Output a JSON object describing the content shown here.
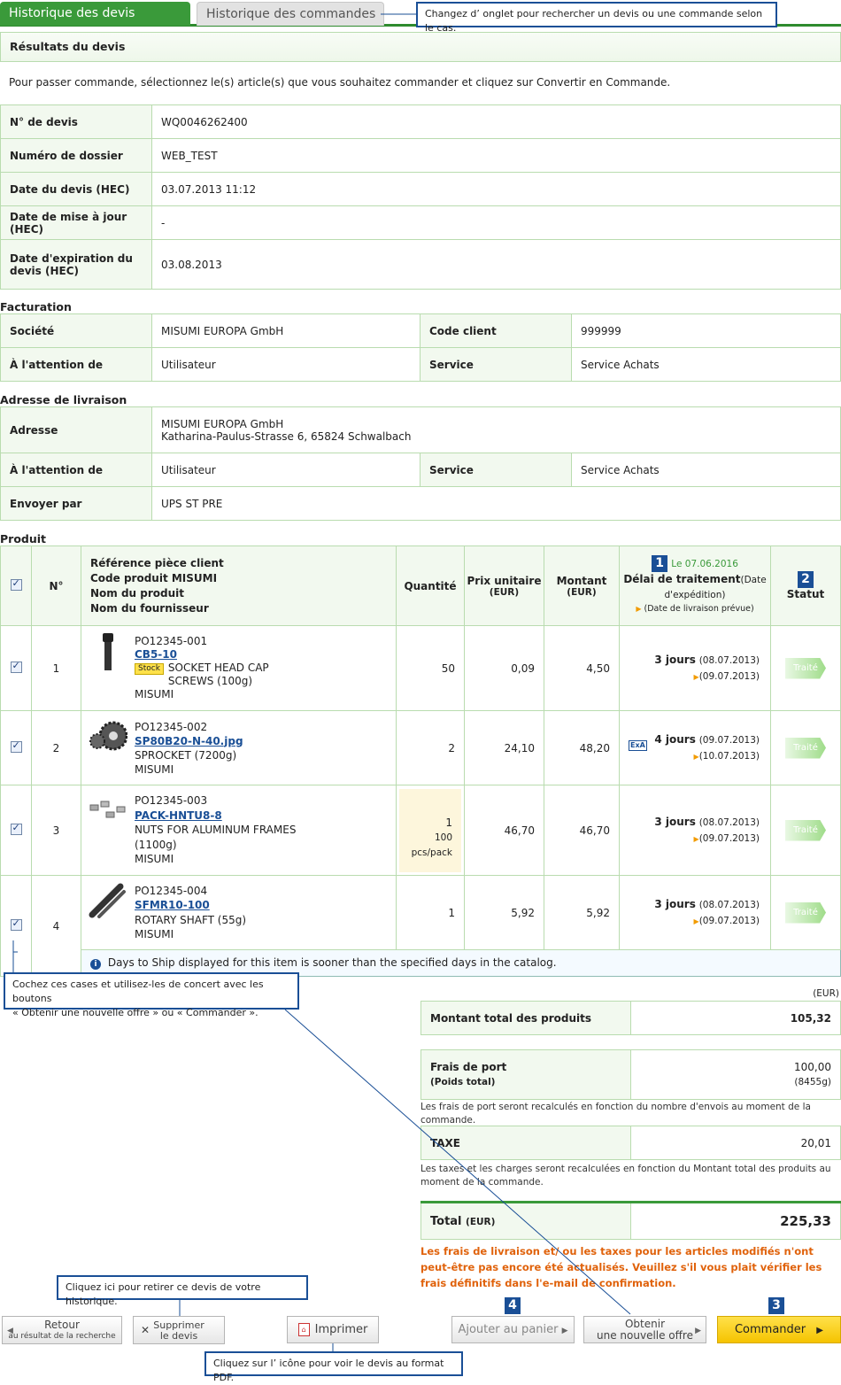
{
  "tabs": {
    "active": "Historique des devis",
    "inactive": "Historique des commandes"
  },
  "callouts": {
    "tabs": "Changez d’ onglet pour rechercher un devis ou une commande selon le cas.",
    "checkboxes_line1": "Cochez ces cases et utilisez-les de concert avec les boutons",
    "checkboxes_line2": "« Obtenir une nouvelle offre » ou « Commander ».",
    "delete": "Cliquez ici pour retirer ce devis de votre historique.",
    "pdf": "Cliquez sur l’ icône pour voir le devis au format PDF."
  },
  "header": {
    "title": "Résultats du devis",
    "intro": "Pour passer commande, sélectionnez le(s) article(s) que vous souhaitez commander et cliquez sur Convertir en Commande."
  },
  "quote_info": [
    {
      "label": "N° de devis",
      "value": "WQ0046262400"
    },
    {
      "label": "Numéro de dossier",
      "value": "WEB_TEST"
    },
    {
      "label": "Date du devis (HEC)",
      "value": "03.07.2013 11:12"
    },
    {
      "label": "Date de mise à jour (HEC)",
      "value": "-"
    },
    {
      "label": "Date d'expiration du devis (HEC)",
      "value": "03.08.2013"
    }
  ],
  "billing": {
    "title": "Facturation",
    "company_label": "Société",
    "company": "MISUMI EUROPA GmbH",
    "client_code_label": "Code client",
    "client_code": "999999",
    "attention_label": "À l'attention de",
    "attention": "Utilisateur",
    "service_label": "Service",
    "service": "Service Achats"
  },
  "shipping": {
    "title": "Adresse de livraison",
    "address_label": "Adresse",
    "address_line1": "MISUMI EUROPA GmbH",
    "address_line2": "Katharina-Paulus-Strasse 6, 65824 Schwalbach",
    "attention_label": "À l'attention de",
    "attention": "Utilisateur",
    "service_label": "Service",
    "service": "Service Achats",
    "ship_by_label": "Envoyer par",
    "ship_by": "UPS ST PRE"
  },
  "products": {
    "title": "Produit",
    "headers": {
      "no": "N°",
      "ref1": "Référence pièce client",
      "ref2": "Code produit MISUMI",
      "ref3": "Nom du produit",
      "ref4": "Nom du fournisseur",
      "qty": "Quantité",
      "unit_price": "Prix unitaire",
      "unit_price_cur": "(EUR)",
      "amount": "Montant",
      "amount_cur": "(EUR)",
      "date_note": "Le 07.06.2016",
      "lead_time": "Délai de traitement",
      "lead_time_sub": "(Date d'expédition)",
      "delivery": "(Date de livraison prévue)",
      "status": "Statut",
      "badge1": "1",
      "badge2": "2"
    },
    "rows": [
      {
        "no": "1",
        "ref": "PO12345-001",
        "code": "CB5-10",
        "stock": "Stock",
        "name": "SOCKET HEAD CAP SCREWS (100g)",
        "supplier": "MISUMI",
        "qty": "50",
        "unit": "0,09",
        "amount": "4,50",
        "days": "3 jours",
        "ship": "(08.07.2013)",
        "deliv": "(09.07.2013)",
        "status": "Traité"
      },
      {
        "no": "2",
        "ref": "PO12345-002",
        "code": "SP80B20-N-40.jpg",
        "name": "SPROCKET (7200g)",
        "supplier": "MISUMI",
        "qty": "2",
        "unit": "24,10",
        "amount": "48,20",
        "exa": "ExA",
        "days": "4 jours",
        "ship": "(09.07.2013)",
        "deliv": "(10.07.2013)",
        "status": "Traité"
      },
      {
        "no": "3",
        "ref": "PO12345-003",
        "code": "PACK-HNTU8-8",
        "name": "NUTS FOR ALUMINUM FRAMES",
        "name2": "(1100g)",
        "supplier": "MISUMI",
        "qty": "1",
        "qty_pack": "100",
        "qty_unit": "pcs/pack",
        "unit": "46,70",
        "amount": "46,70",
        "days": "3 jours",
        "ship": "(08.07.2013)",
        "deliv": "(09.07.2013)",
        "status": "Traité"
      },
      {
        "no": "4",
        "ref": "PO12345-004",
        "code": "SFMR10-100",
        "name": "ROTARY SHAFT (55g)",
        "supplier": "MISUMI",
        "qty": "1",
        "unit": "5,92",
        "amount": "5,92",
        "days": "3 jours",
        "ship": "(08.07.2013)",
        "deliv": "(09.07.2013)",
        "status": "Traité"
      }
    ],
    "info_note": "Days to Ship displayed for this item is sooner than the specified days in the catalog."
  },
  "totals": {
    "currency": "(EUR)",
    "products_label": "Montant total des produits",
    "products": "105,32",
    "shipping_label": "Frais de port",
    "shipping_sub": "(Poids total)",
    "shipping": "100,00",
    "weight": "(8455g)",
    "shipping_note": "Les frais de port seront recalculés en fonction du nombre d'envois au moment de la commande.",
    "tax_label": "TAXE",
    "tax": "20,01",
    "tax_note": "Les taxes et les charges seront recalculées en fonction du Montant total des produits au moment de la commande.",
    "total_label": "Total",
    "total_cur": "(EUR)",
    "total": "225,33",
    "warning": "Les frais de livraison et/ ou les taxes pour les articles modifiés n'ont peut-être pas encore été actualisés. Veuillez s'il vous plait vérifier les frais définitifs dans l'e-mail de confirmation."
  },
  "buttons": {
    "back1": "Retour",
    "back2": "au résultat de la recherche",
    "delete1": "Supprimer",
    "delete2": "le devis",
    "print": "Imprimer",
    "cart": "Ajouter au panier",
    "new_offer1": "Obtenir",
    "new_offer2": "une nouvelle offre",
    "order": "Commander",
    "badge3": "3",
    "badge4": "4"
  }
}
